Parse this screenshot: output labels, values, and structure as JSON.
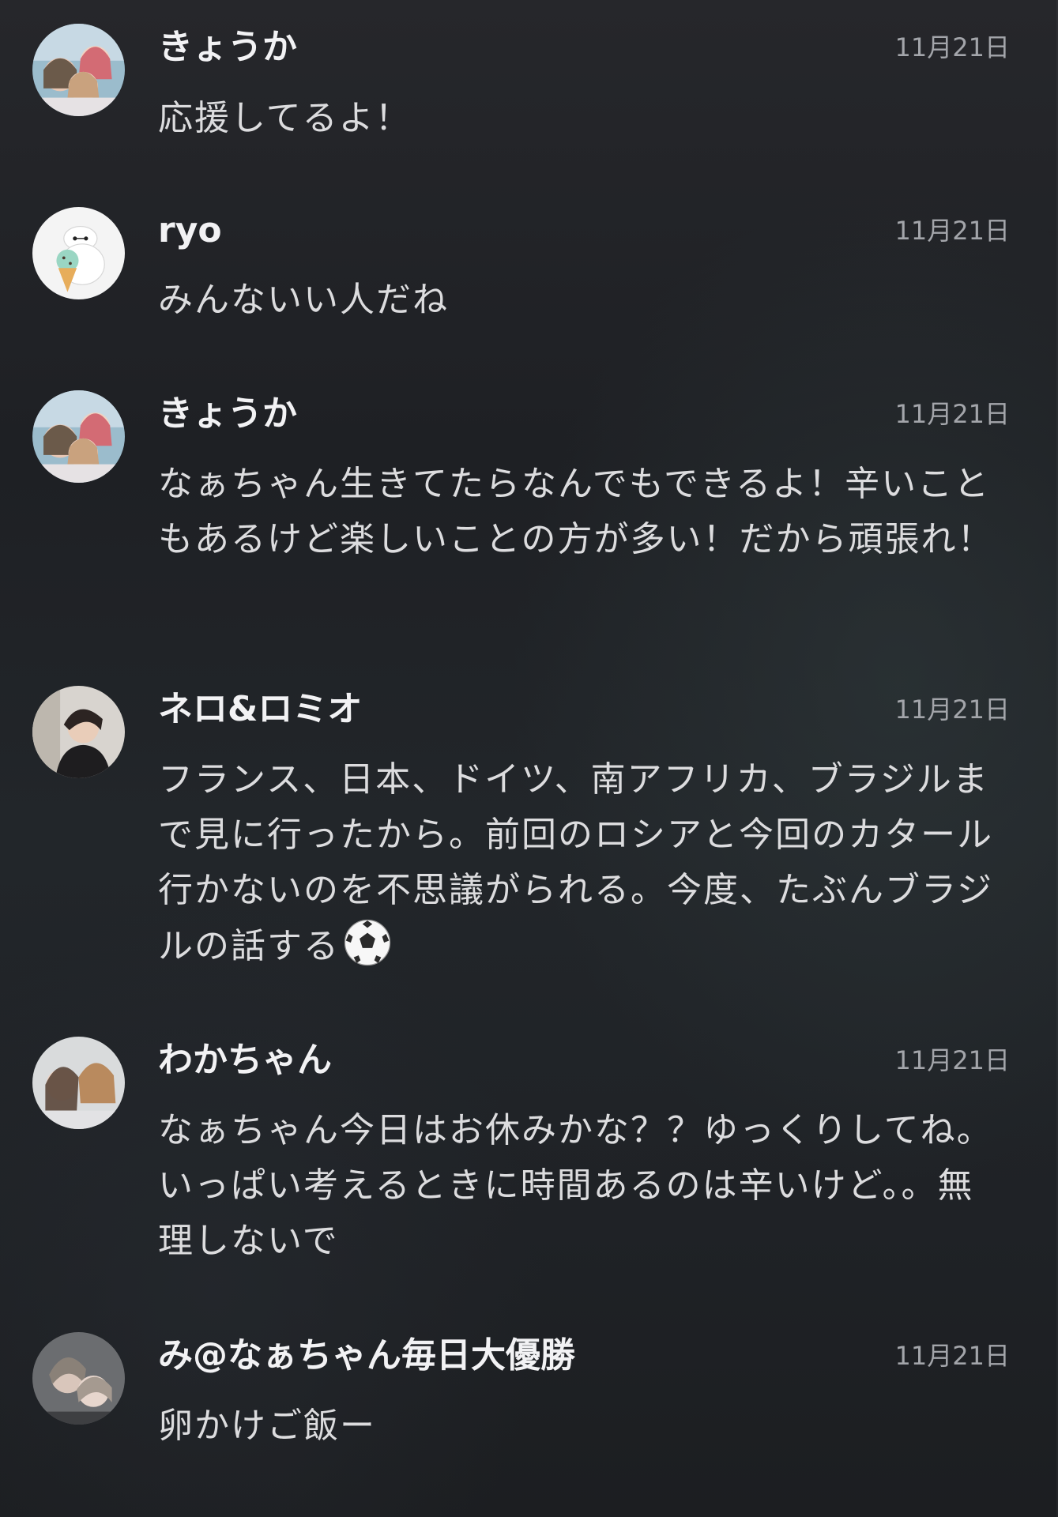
{
  "comments": [
    {
      "user": "きょうか",
      "date": "11月21日",
      "text": "応援してるよ！",
      "avatar_icon": "group-photo-avatar"
    },
    {
      "user": "ryo",
      "date": "11月21日",
      "text": "みんないい人だね",
      "avatar_icon": "robot-icecream-avatar"
    },
    {
      "user": "きょうか",
      "date": "11月21日",
      "text": "なぁちゃん生きてたらなんでもできるよ！辛いこともあるけど楽しいことの方が多い！だから頑張れ！",
      "avatar_icon": "group-photo-avatar"
    },
    {
      "user": "ネロ&ロミオ",
      "date": "11月21日",
      "text": "フランス、日本、ドイツ、南アフリカ、ブラジルまで見に行ったから。前回のロシアと今回のカタール行かないのを不思議がられる。今度、たぶんブラジルの話する",
      "emoji": "soccer-ball-icon",
      "avatar_icon": "person-photo-avatar"
    },
    {
      "user": "わかちゃん",
      "date": "11月21日",
      "text": "なぁちゃん今日はお休みかな？？ゆっくりしてね。 いっぱい考えるときに時間あるのは辛いけど。。無理しないで",
      "avatar_icon": "duo-photo-avatar"
    },
    {
      "user": "み@なぁちゃん毎日大優勝",
      "date": "11月21日",
      "text": "卵かけご飯ー",
      "avatar_icon": "duo-photo-avatar"
    }
  ]
}
